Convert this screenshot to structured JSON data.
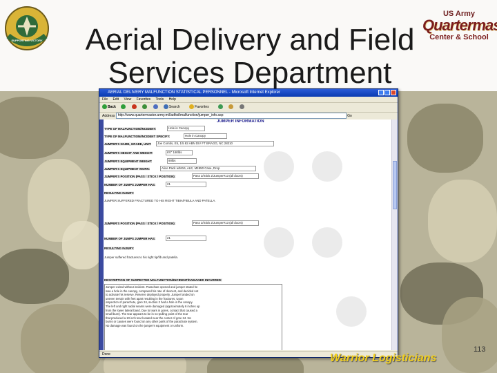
{
  "slide": {
    "title_line1": "Aerial Delivery and Field",
    "title_line2": "Services Department",
    "page_number": "113",
    "footer": "Warrior Logisticians",
    "logo_left_text": "SUPPORTING VICTORY",
    "logo_right": {
      "line1": "US Army",
      "line2": "Quartermaster",
      "line3": "Center & School"
    }
  },
  "browser": {
    "window_title": "AERIAL DELIVERY MALFUNCTION STATISTICAL PERSONNEL - Microsoft Internet Explorer",
    "menu": [
      "File",
      "Edit",
      "View",
      "Favorites",
      "Tools",
      "Help"
    ],
    "toolbar": [
      "Back",
      "Search",
      "Favorites"
    ],
    "address_label": "Address",
    "address": "http://www.quartermaster.army.mil/adfsd/malfunction/jumper_info.asp",
    "go_label": "Go",
    "status": "Done"
  },
  "form": {
    "section_title": "JUMPER INFORMATION",
    "fields": [
      {
        "label": "TYPE OF MALFUNCTION/INCIDENT:",
        "value": "Hole in Canopy"
      },
      {
        "label": "TYPE OF MALFUNCTION/INCIDENT SPECIFY:",
        "value": "Hole in Canopy"
      },
      {
        "label": "JUMPER'S NAME, GRADE, UNIT:",
        "value": "Joe Combs, E5, 1/5 82 ABN DIV FT BRAGG, NC 28310"
      },
      {
        "label": "JUMPER'S HEIGHT AND WEIGHT:",
        "value": "6'0\" 180lbs"
      },
      {
        "label": "JUMPER'S EQUIPMENT WEIGHT:",
        "value": "90lbs"
      },
      {
        "label": "JUMPER'S EQUIPMENT WORN:",
        "value": "Alice Pack w/M16, ALE, M1950 Case, Drop"
      },
      {
        "label": "JUMPER'S POSITION (PASS / STICK / POSITION):",
        "value": "Pass 2/Stick 2/Jumper#13 (all doors)"
      },
      {
        "label": "NUMBER OF JUMPS JUMPER HAS:",
        "value": "21"
      },
      {
        "label": "RESULTING INJURY:",
        "value": ""
      },
      {
        "label": "JUMPER SUFFERED FRACTURED TO HIS RIGHT TIBIA/FIBULA AND PATELLA.",
        "value": ""
      },
      {
        "label": "JUMPER'S POSITION (PASS / STICK / POSITION):",
        "value": "Pass 2/Stick 2/Jumper#13 (all doors)"
      },
      {
        "label": "NUMBER OF JUMPS JUMPER HAS:",
        "value": "21"
      },
      {
        "label": "RESULTING INJURY:",
        "value": ""
      },
      {
        "label": "Jumper suffered fractures to his right tip/fib and patella.",
        "value": ""
      },
      {
        "label": "DESCRIPTION OF SUSPECTED MALFUNCTION/INCIDENT/DAMAGED INCURRED:",
        "value": ""
      }
    ],
    "description_text": [
      "Jumper exited without incident. Parachute opened and jumper stated he",
      "saw a hole in the canopy, compared his rate of descent, and decided not",
      "to activate his reserve. Reserve deployed properly. Jumper landed on",
      "uneven terrain with feet apart resulting in the fractures. Upon",
      "inspection of parachute, gore 24, section 2 had a hole in the canopy.",
      "The left and right radial seams were damaged (approximately 6 inches up",
      "from the lower lateral band. Due to tears in gores, contact that caused a",
      "small burn). The tear appears to be in no-pulling point of the tear",
      "that produced a 10 inch tear located near the center of gore 24. No",
      "burns or causes were found on any other parts of the parachute system.",
      "No damage was found on the jumper's equipment or uniform."
    ]
  }
}
